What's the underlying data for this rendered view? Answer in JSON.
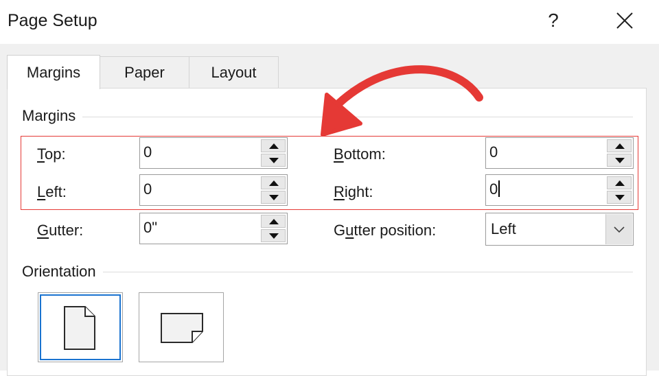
{
  "window": {
    "title": "Page Setup",
    "help_label": "?"
  },
  "tabs": [
    {
      "label": "Margins",
      "active": true
    },
    {
      "label": "Paper",
      "active": false
    },
    {
      "label": "Layout",
      "active": false
    }
  ],
  "margins": {
    "group_label": "Margins",
    "top": {
      "label_access": "T",
      "label_rest": "op:",
      "value": "0"
    },
    "bottom": {
      "label_access": "B",
      "label_rest": "ottom:",
      "value": "0"
    },
    "left": {
      "label_access": "L",
      "label_rest": "eft:",
      "value": "0"
    },
    "right": {
      "label_access": "R",
      "label_rest": "ight:",
      "value": "0"
    },
    "gutter": {
      "label_access": "G",
      "label_rest": "utter:",
      "value": "0\""
    },
    "gutter_position": {
      "label_pre": "G",
      "label_access": "u",
      "label_rest": "tter position:",
      "value": "Left"
    }
  },
  "orientation": {
    "group_label": "Orientation",
    "selected": "portrait"
  },
  "colors": {
    "accent": "#1a73d0",
    "annotation": "#e53935",
    "dialog_bg": "#f0f0f0"
  },
  "icons": {
    "help": "question-mark-icon",
    "close": "close-x-icon",
    "spin_up": "triangle-up-icon",
    "spin_down": "triangle-down-icon",
    "dropdown": "chevron-down-icon",
    "portrait": "portrait-page-icon",
    "landscape": "landscape-page-icon"
  }
}
